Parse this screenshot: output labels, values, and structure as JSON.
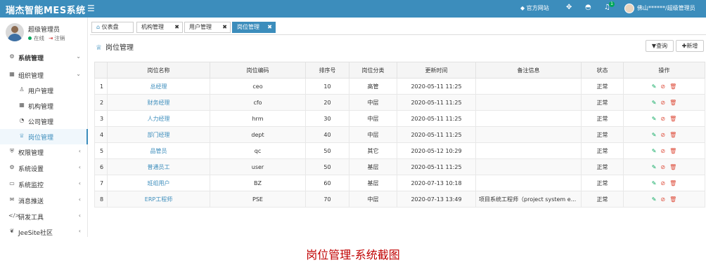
{
  "app": {
    "title": "瑞杰智能MES系统"
  },
  "topbar": {
    "site_label": "官方网站",
    "notification_count": "1",
    "user_label": "佛山******/超级管理员"
  },
  "sidebar": {
    "user_name": "超级管理员",
    "status_online": "在线",
    "logout": "注销",
    "items": [
      {
        "label": "系统管理",
        "icon": "gear-icon",
        "arrow": "⌄"
      },
      {
        "label": "组织管理",
        "icon": "grid-icon",
        "arrow": "⌄"
      },
      {
        "label": "用户管理",
        "icon": "user-icon"
      },
      {
        "label": "机构管理",
        "icon": "grid-icon"
      },
      {
        "label": "公司管理",
        "icon": "company-icon"
      },
      {
        "label": "岗位管理",
        "icon": "trophy-icon"
      },
      {
        "label": "权限管理",
        "icon": "shield-icon",
        "arrow": "‹"
      },
      {
        "label": "系统设置",
        "icon": "settings-icon",
        "arrow": "‹"
      },
      {
        "label": "系统监控",
        "icon": "monitor-icon",
        "arrow": "‹"
      },
      {
        "label": "消息推送",
        "icon": "message-icon",
        "arrow": "‹"
      },
      {
        "label": "研发工具",
        "icon": "code-icon",
        "arrow": "‹"
      },
      {
        "label": "JeeSite社区",
        "icon": "community-icon",
        "arrow": "‹"
      }
    ]
  },
  "tabs": [
    {
      "label": "仪表盘",
      "icon": "home-icon"
    },
    {
      "label": "机构管理"
    },
    {
      "label": "用户管理"
    },
    {
      "label": "岗位管理",
      "active": true
    }
  ],
  "page": {
    "title": "岗位管理",
    "query_button": "查询",
    "add_button": "新增"
  },
  "table": {
    "headers": [
      "",
      "岗位名称",
      "岗位编码",
      "排序号",
      "岗位分类",
      "更新时间",
      "备注信息",
      "状态",
      "操作"
    ],
    "rows": [
      [
        "1",
        "总经理",
        "ceo",
        "10",
        "高管",
        "2020-05-11 11:25",
        "",
        "正常"
      ],
      [
        "2",
        "财务经理",
        "cfo",
        "20",
        "中层",
        "2020-05-11 11:25",
        "",
        "正常"
      ],
      [
        "3",
        "人力经理",
        "hrm",
        "30",
        "中层",
        "2020-05-11 11:25",
        "",
        "正常"
      ],
      [
        "4",
        "部门经理",
        "dept",
        "40",
        "中层",
        "2020-05-11 11:25",
        "",
        "正常"
      ],
      [
        "5",
        "品管员",
        "qc",
        "50",
        "其它",
        "2020-05-12 10:29",
        "",
        "正常"
      ],
      [
        "6",
        "普通员工",
        "user",
        "50",
        "基层",
        "2020-05-11 11:25",
        "",
        "正常"
      ],
      [
        "7",
        "班组用户",
        "BZ",
        "60",
        "基层",
        "2020-07-13 10:18",
        "",
        "正常"
      ],
      [
        "8",
        "ERP工程师",
        "PSE",
        "70",
        "中层",
        "2020-07-13 13:49",
        "项目系统工程师（project system e...",
        "正常"
      ]
    ]
  },
  "caption": "岗位管理-系统截图",
  "colors": {
    "primary": "#3c8dbc",
    "caption": "#c00000",
    "edit": "#00a65a",
    "danger": "#dd4b39"
  }
}
